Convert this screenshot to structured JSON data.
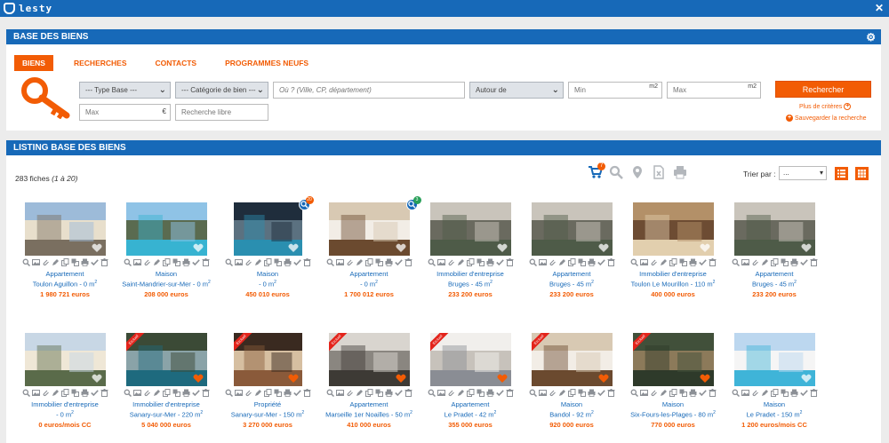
{
  "app": {
    "logo_text": "lesty"
  },
  "search_panel": {
    "title": "BASE DES BIENS",
    "tabs": [
      {
        "label": "BIENS",
        "active": true
      },
      {
        "label": "RECHERCHES",
        "active": false
      },
      {
        "label": "CONTACTS",
        "active": false
      },
      {
        "label": "PROGRAMMES NEUFS",
        "active": false
      }
    ],
    "type_base": "--- Type Base ---",
    "categorie": "--- Catégorie de bien ---",
    "location_placeholder": "Où ? (Ville, CP, département)",
    "autour": "Autour de",
    "min_placeholder": "Min",
    "max_placeholder": "Max",
    "unit_m2": "m2",
    "price_max_placeholder": "Max",
    "unit_euro": "€",
    "free_search_placeholder": "Recherche libre",
    "search_button": "Rechercher",
    "more_criteria": "Plus de critères",
    "save_search": "Sauvegarder la recherche",
    "accent_color": "#f25c05",
    "brand_color": "#1769b8"
  },
  "listing": {
    "title": "LISTING BASE DES BIENS",
    "count_text": "283 fiches",
    "range_text": "(1 à 20)",
    "cart_count": "7",
    "sort_label": "Trier par :",
    "sort_value": "...",
    "items": [
      {
        "type": "Appartement",
        "loc": "Toulon Aguillon - 0 m",
        "price": "1 980 721 euros",
        "img": "building"
      },
      {
        "type": "Maison",
        "loc": "Saint-Mandrier-sur-Mer - 0 m",
        "price": "208 000 euros",
        "img": "coast"
      },
      {
        "type": "Maison",
        "loc": "- 0 m",
        "price": "450 010 euros",
        "img": "pool-night",
        "badge": "20",
        "badge_color": "#f25c05"
      },
      {
        "type": "Appartement",
        "loc": "- 0 m",
        "price": "1 700 012 euros",
        "img": "interior-wood",
        "badge": "3",
        "badge_color": "#2aa05a"
      },
      {
        "type": "Immobilier d'entreprise",
        "loc": "Bruges - 45 m",
        "price": "233 200 euros",
        "img": "terrace"
      },
      {
        "type": "Appartement",
        "loc": "Bruges - 45 m",
        "price": "233 200 euros",
        "img": "terrace"
      },
      {
        "type": "Immobilier d'entreprise",
        "loc": "Toulon Le Mourillon - 110 m",
        "price": "400 000 euros",
        "img": "living"
      },
      {
        "type": "Appartement",
        "loc": "Bruges - 45 m",
        "price": "233 200 euros",
        "img": "terrace"
      },
      {
        "type": "Immobilier d'entreprise",
        "loc": "- 0 m",
        "price": "0 euros/mois CC",
        "img": "villa"
      },
      {
        "type": "Immobilier d'entreprise",
        "loc": "Sanary-sur-Mer - 220 m",
        "price": "5 040 000 euros",
        "img": "infinity",
        "ribbon": "Exclusif"
      },
      {
        "type": "Propriété",
        "loc": "Sanary-sur-Mer - 150 m",
        "price": "3 270 000 euros",
        "img": "palace",
        "ribbon": "Exclusif"
      },
      {
        "type": "Appartement",
        "loc": "Marseille 1er Noailles - 50 m",
        "price": "410 000 euros",
        "img": "kitchen",
        "ribbon": "Exclusif"
      },
      {
        "type": "Appartement",
        "loc": "Le Pradet - 42 m",
        "price": "355 000 euros",
        "img": "sofa",
        "ribbon": "Exclusif"
      },
      {
        "type": "Maison",
        "loc": "Bandol - 92 m",
        "price": "920 000 euros",
        "img": "interior-wood",
        "ribbon": "Exclusif"
      },
      {
        "type": "Maison",
        "loc": "Six-Fours-les-Plages - 80 m",
        "price": "770 000 euros",
        "img": "garden",
        "ribbon": "Exclusif"
      },
      {
        "type": "Maison",
        "loc": "Le Pradet - 150 m",
        "price": "1 200 euros/mois CC",
        "img": "modern"
      }
    ]
  }
}
